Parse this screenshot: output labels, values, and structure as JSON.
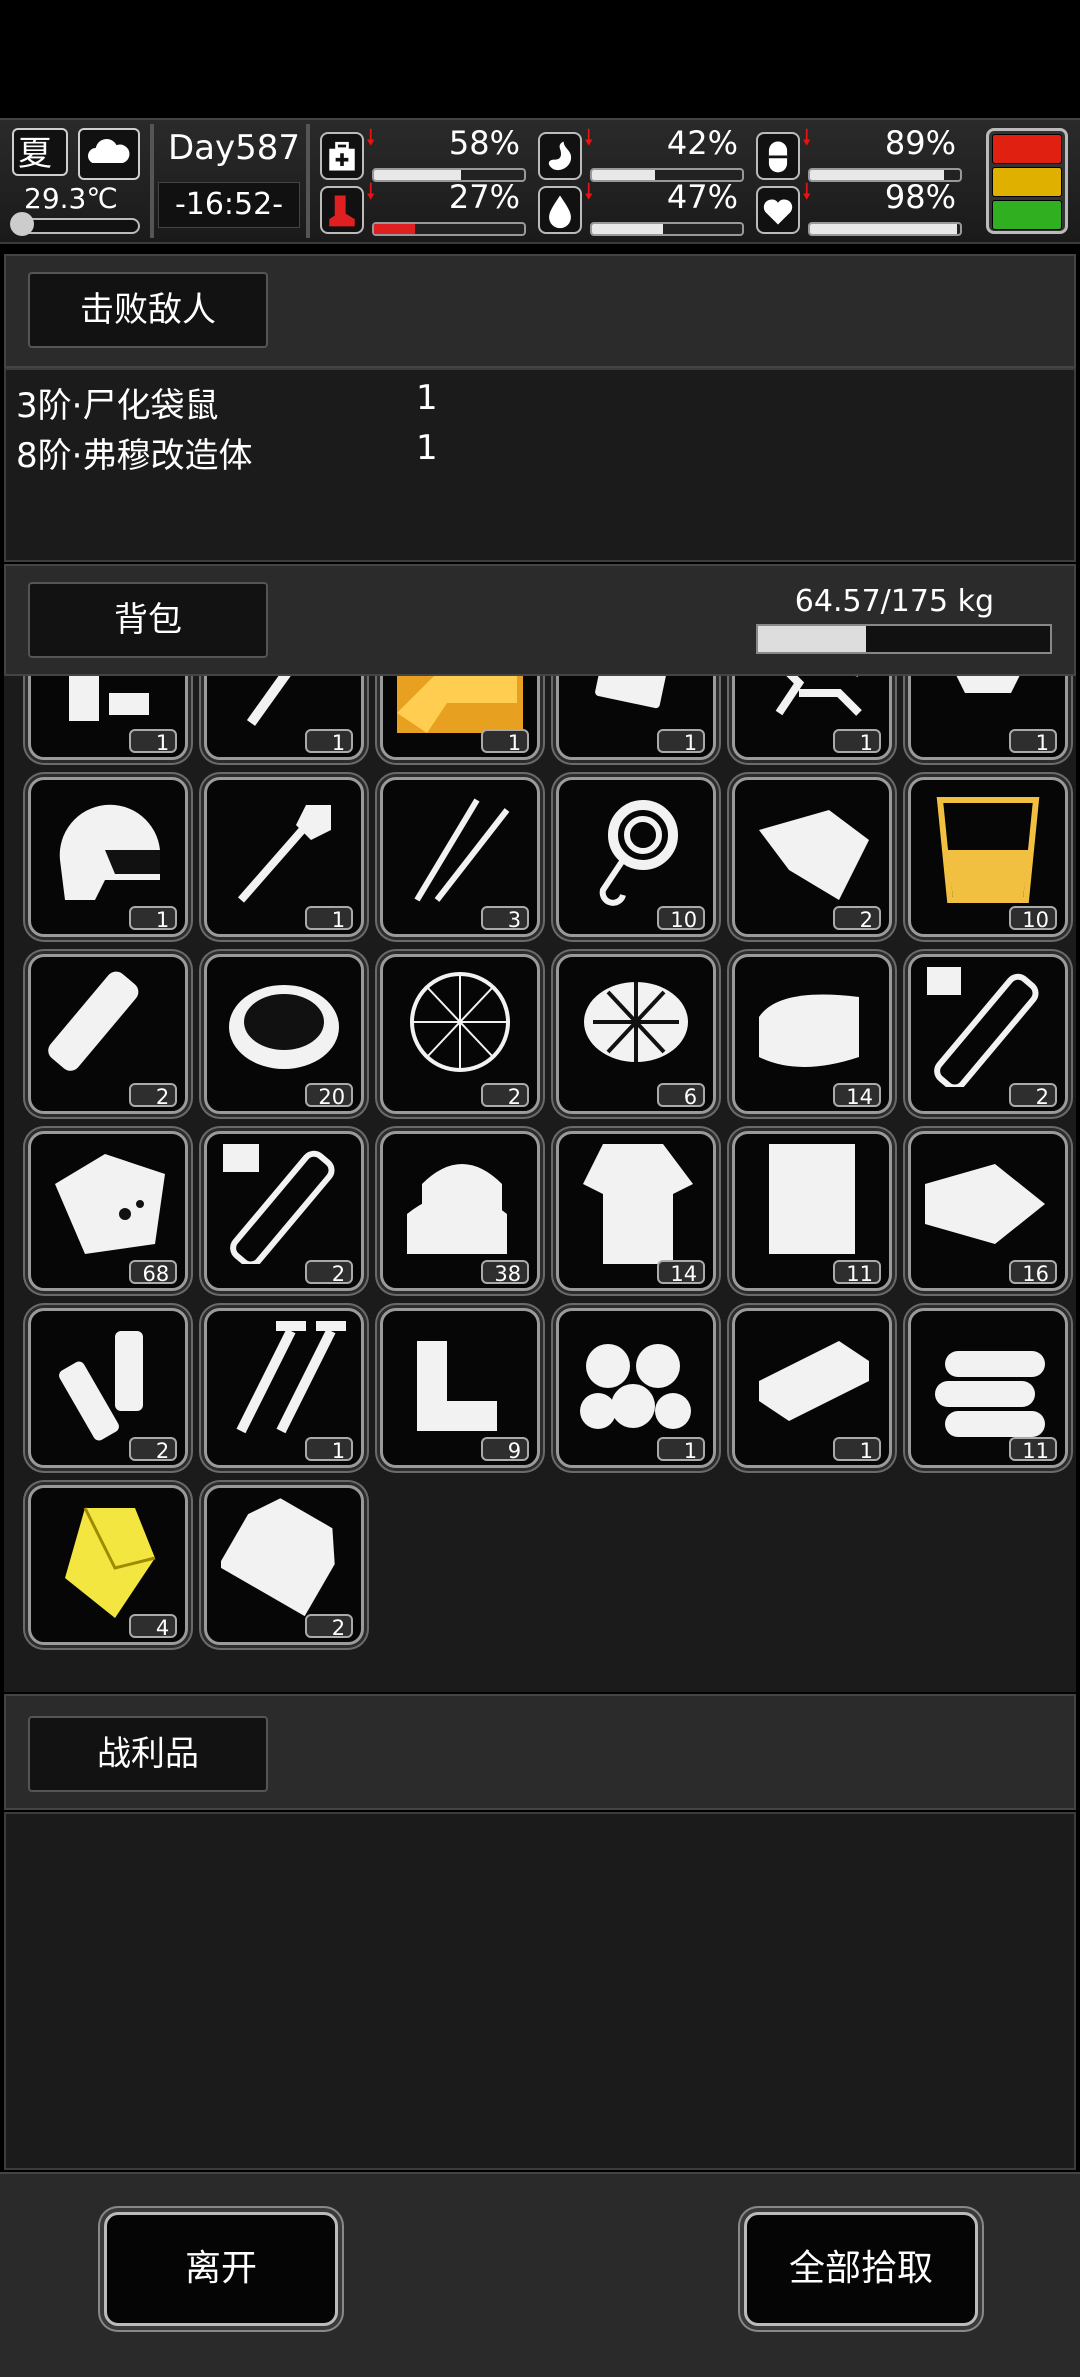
{
  "status": {
    "season": "夏",
    "temperature": "29.3℃",
    "day": "Day587",
    "time": "-16:52-",
    "stats": [
      {
        "icon": "medkit-icon",
        "value": "58%",
        "level": 0.58,
        "color": "#ffffff"
      },
      {
        "icon": "stomach-icon",
        "value": "42%",
        "level": 0.42,
        "color": "#ffffff"
      },
      {
        "icon": "pill-icon",
        "value": "89%",
        "level": 0.89,
        "color": "#ffffff"
      },
      {
        "icon": "boot-icon",
        "value": "27%",
        "level": 0.27,
        "color": "#e02020"
      },
      {
        "icon": "water-drop-icon",
        "value": "47%",
        "level": 0.47,
        "color": "#ffffff"
      },
      {
        "icon": "heart-icon",
        "value": "98%",
        "level": 0.98,
        "color": "#ffffff"
      }
    ],
    "traffic_colors": [
      "#e02010",
      "#e0b000",
      "#30b020"
    ]
  },
  "defeated": {
    "tab_label": "击败敌人",
    "enemies": [
      {
        "name": "3阶·尸化袋鼠",
        "count": "1"
      },
      {
        "name": "8阶·弗穆改造体",
        "count": "1"
      }
    ]
  },
  "backpack": {
    "tab_label": "背包",
    "weight": "64.57/175 kg",
    "weight_level": 0.369,
    "items": [
      {
        "icon": "tripod-icon",
        "count": "1"
      },
      {
        "icon": "hatchet-icon",
        "count": "1"
      },
      {
        "icon": "golden-rifle-icon",
        "count": "1"
      },
      {
        "icon": "case-icon",
        "count": "1"
      },
      {
        "icon": "scrap-parts-icon",
        "count": "1"
      },
      {
        "icon": "armor-icon",
        "count": "1"
      },
      {
        "icon": "helmet-icon",
        "count": "1"
      },
      {
        "icon": "shovel-icon",
        "count": "1"
      },
      {
        "icon": "tweezers-icon",
        "count": "3"
      },
      {
        "icon": "rope-icon",
        "count": "10"
      },
      {
        "icon": "cloth-scrap-icon",
        "count": "2"
      },
      {
        "icon": "fuel-jar-icon",
        "count": "10"
      },
      {
        "icon": "bandage-roll-icon",
        "count": "2"
      },
      {
        "icon": "soup-bowl-icon",
        "count": "20"
      },
      {
        "icon": "net-icon",
        "count": "2"
      },
      {
        "icon": "net-spiked-icon",
        "count": "6"
      },
      {
        "icon": "folded-towel-icon",
        "count": "14"
      },
      {
        "icon": "test-tube-1-icon",
        "count": "2"
      },
      {
        "icon": "ore-rock-icon",
        "count": "68"
      },
      {
        "icon": "test-tube-4-icon",
        "count": "2"
      },
      {
        "icon": "cloth-pile-icon",
        "count": "38"
      },
      {
        "icon": "torn-shirt-icon",
        "count": "14"
      },
      {
        "icon": "paper-sheet-icon",
        "count": "11"
      },
      {
        "icon": "fabric-icon",
        "count": "16"
      },
      {
        "icon": "battery-icon",
        "count": "2"
      },
      {
        "icon": "screws-icon",
        "count": "1"
      },
      {
        "icon": "rubber-scrap-icon",
        "count": "9"
      },
      {
        "icon": "cotton-balls-icon",
        "count": "1"
      },
      {
        "icon": "metal-plate-icon",
        "count": "1"
      },
      {
        "icon": "logs-icon",
        "count": "11"
      },
      {
        "icon": "gold-crystal-icon",
        "count": "4"
      },
      {
        "icon": "plastic-bag-icon",
        "count": "2"
      }
    ]
  },
  "loot": {
    "tab_label": "战利品"
  },
  "buttons": {
    "leave": "离开",
    "pick_all": "全部拾取"
  }
}
